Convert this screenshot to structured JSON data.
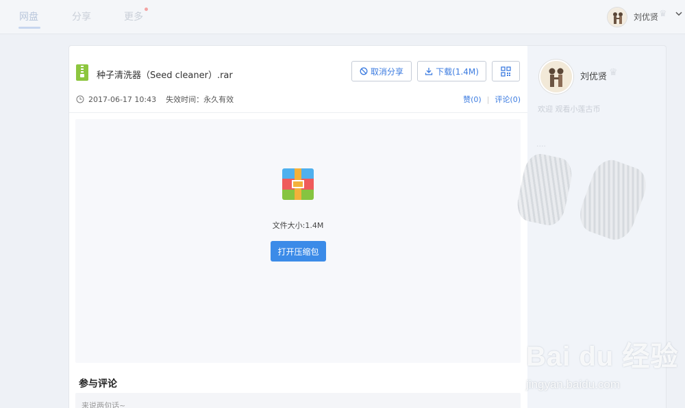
{
  "nav": {
    "tabs": [
      {
        "label": "网盘"
      },
      {
        "label": "分享"
      },
      {
        "label": "更多"
      }
    ]
  },
  "user": {
    "name": "刘优贤",
    "welcome": "欢迎 观看小莲古币",
    "side_faint": "...."
  },
  "file": {
    "name": "种子清洗器（Seed cleaner）.rar",
    "share_time": "2017-06-17 10:43",
    "expire": "失效时间：永久有效",
    "size_label": "文件大小:1.4M"
  },
  "actions": {
    "cancel_share": "取消分享",
    "download": "下载(1.4M)",
    "like": "赞(0)",
    "comment": "评论(0)",
    "open_archive": "打开压缩包"
  },
  "comments": {
    "title": "参与评论",
    "placeholder": "来说两句话~"
  },
  "watermark": {
    "brand": "Bai du 经验",
    "url": "jingyan.baidu.com"
  },
  "colors": {
    "accent": "#3b8be8",
    "link": "#3b7be0"
  }
}
